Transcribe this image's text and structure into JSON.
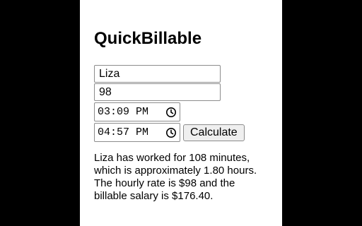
{
  "app": {
    "title": "QuickBillable"
  },
  "form": {
    "name_value": "Liza",
    "rate_value": "98",
    "start_time_value": "03:09 PM",
    "end_time_value": "04:57 PM",
    "calculate_label": "Calculate"
  },
  "result": {
    "text": "Liza has worked for 108 minutes, which is approximately 1.80 hours. The hourly rate is $98 and the billable salary is $176.40."
  },
  "icons": {
    "time_picker": "clock-icon"
  },
  "colors": {
    "background": "#000000",
    "panel": "#ffffff",
    "button": "#efefef",
    "border": "#8c8c8c"
  }
}
